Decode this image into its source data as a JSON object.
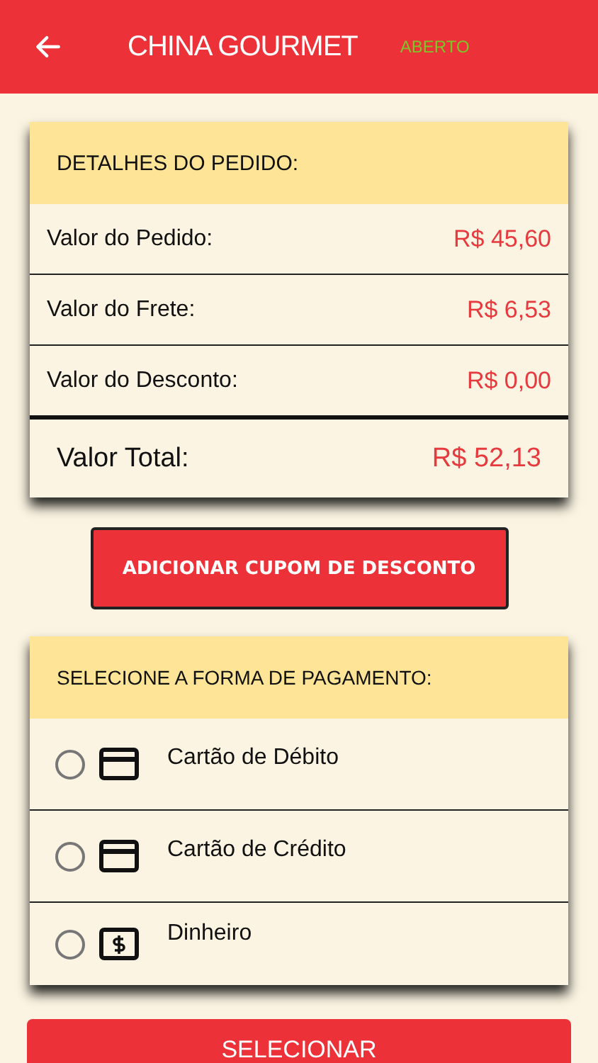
{
  "header": {
    "title": "CHINA GOURMET",
    "status": "ABERTO"
  },
  "order": {
    "title": "DETALHES DO PEDIDO:",
    "rows": [
      {
        "label": "Valor do Pedido:",
        "value": "R$ 45,60"
      },
      {
        "label": "Valor do Frete:",
        "value": "R$ 6,53"
      },
      {
        "label": "Valor do Desconto:",
        "value": "R$ 0,00"
      }
    ],
    "total": {
      "label": "Valor Total:",
      "value": "R$ 52,13"
    }
  },
  "coupon_button": "ADICIONAR CUPOM DE DESCONTO",
  "payment": {
    "title": "SELECIONE A FORMA DE PAGAMENTO:",
    "options": [
      {
        "label": "Cartão de Débito",
        "kind": "card",
        "selected": false
      },
      {
        "label": "Cartão de Crédito",
        "kind": "card",
        "selected": false
      },
      {
        "label": "Dinheiro",
        "kind": "cash",
        "selected": false
      }
    ]
  },
  "select_button": "SELECIONAR"
}
